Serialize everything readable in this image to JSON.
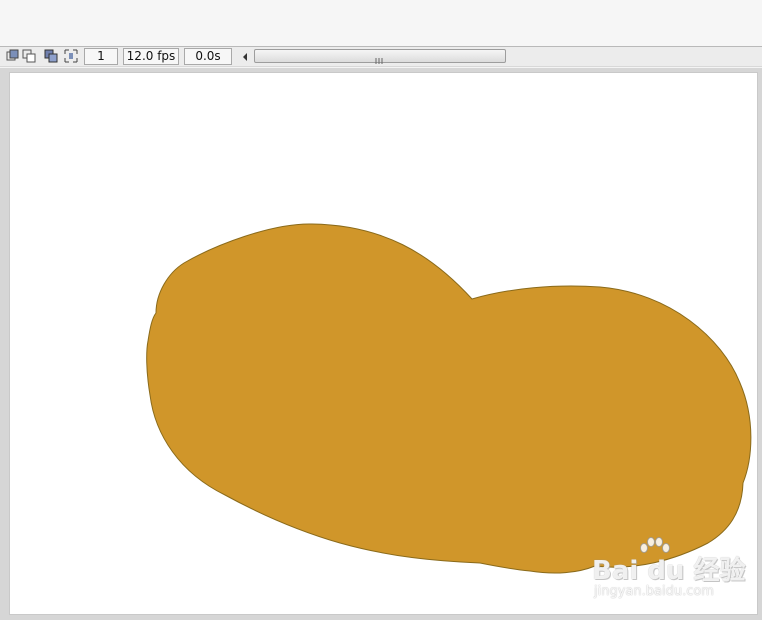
{
  "timeline": {
    "frame_number": "1",
    "frame_rate": "12.0 fps",
    "elapsed_time": "0.0s",
    "icons": [
      "center-frame-icon",
      "onion-skin-icon",
      "onion-skin-outlines-icon",
      "edit-multiple-frames-icon"
    ]
  },
  "stage": {
    "background_color": "#ffffff",
    "shape_fill_color": "#d0962a",
    "shape_stroke_color": "#8a6a1a"
  },
  "watermark": {
    "main_text": "Bai du 经验",
    "sub_text": "jingyan.baidu.com"
  }
}
